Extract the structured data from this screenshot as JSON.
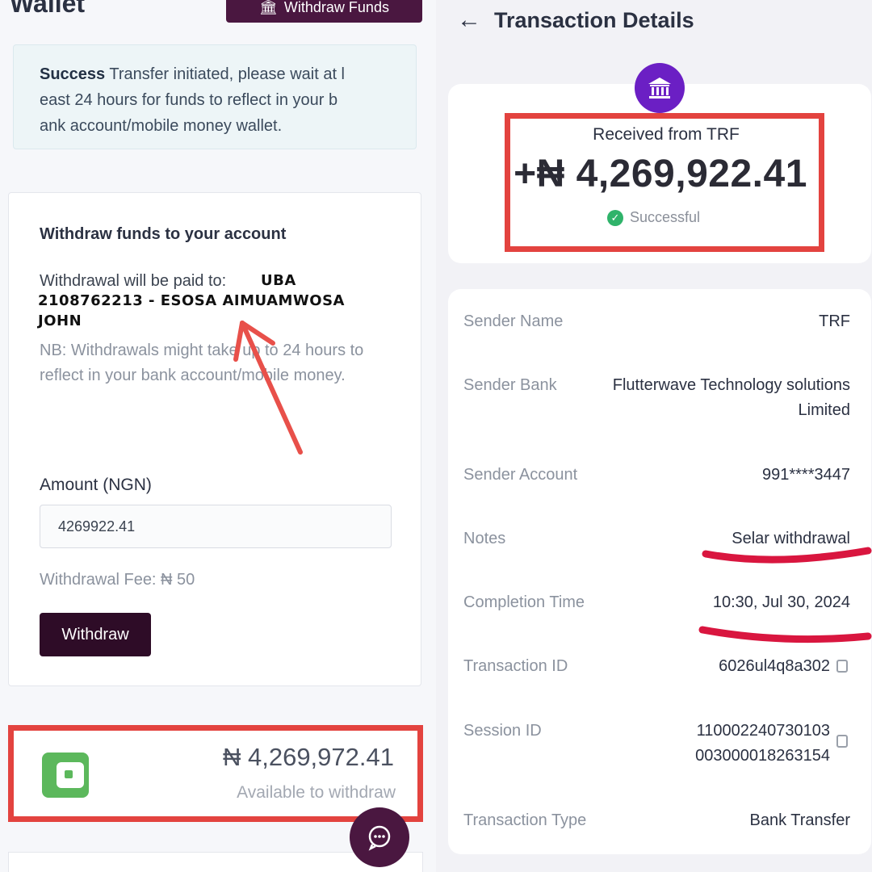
{
  "left": {
    "wallet_title": "Wallet",
    "top_button_label": "Withdraw Funds",
    "success_title": "Success",
    "success_message_line1": "Transfer initiated, please wait at l",
    "success_message_line2": "east 24 hours for funds to reflect in your b",
    "success_message_line3": "ank account/mobile money wallet.",
    "card_title": "Withdraw funds to your account",
    "paid_to_label": "Withdrawal will be paid to:",
    "paid_to_value_line1": "UBA",
    "paid_to_value_line2": "2108762213 - ESOSA AIMUAMWOSA JOHN",
    "nb_text": "NB: Withdrawals might take up to 24 hours to reflect in your bank account/mobile money.",
    "amount_label": "Amount (NGN)",
    "amount_value": "4269922.41",
    "fee_text": "Withdrawal Fee: ₦ 50",
    "withdraw_button": "Withdraw",
    "balance_amount": "₦ 4,269,972.41",
    "balance_subtext": "Available to withdraw"
  },
  "right": {
    "title": "Transaction Details",
    "received_from": "Received from TRF",
    "amount": "+₦ 4,269,922.41",
    "status": "Successful",
    "rows": [
      {
        "label": "Sender Name",
        "value": "TRF"
      },
      {
        "label": "Sender Bank",
        "value": "Flutterwave Technology solutions Limited"
      },
      {
        "label": "Sender Account",
        "value": "991****3447"
      },
      {
        "label": "Notes",
        "value": "Selar withdrawal"
      },
      {
        "label": "Completion Time",
        "value": "10:30, Jul 30, 2024"
      },
      {
        "label": "Transaction ID",
        "value": "6026ul4q8a302"
      },
      {
        "label": "Session ID",
        "value": "110002240730103003000018263154"
      },
      {
        "label": "Transaction Type",
        "value": "Bank Transfer"
      }
    ],
    "session_id_line1": "110002240730103",
    "session_id_line2": "003000018263154",
    "sender_bank_line1": "Flutterwave Technology solutions",
    "sender_bank_line2": "Limited"
  },
  "colors": {
    "brand_purple_dark": "#4a1740",
    "withdraw_button": "#2e0c27",
    "bank_icon": "#6b1fc4",
    "success_green": "#2fb36a",
    "annotation_red": "#e3433f"
  },
  "icons": [
    "bank-icon",
    "back-arrow-icon",
    "wallet-icon",
    "chat-icon",
    "copy-icon",
    "check-icon"
  ]
}
